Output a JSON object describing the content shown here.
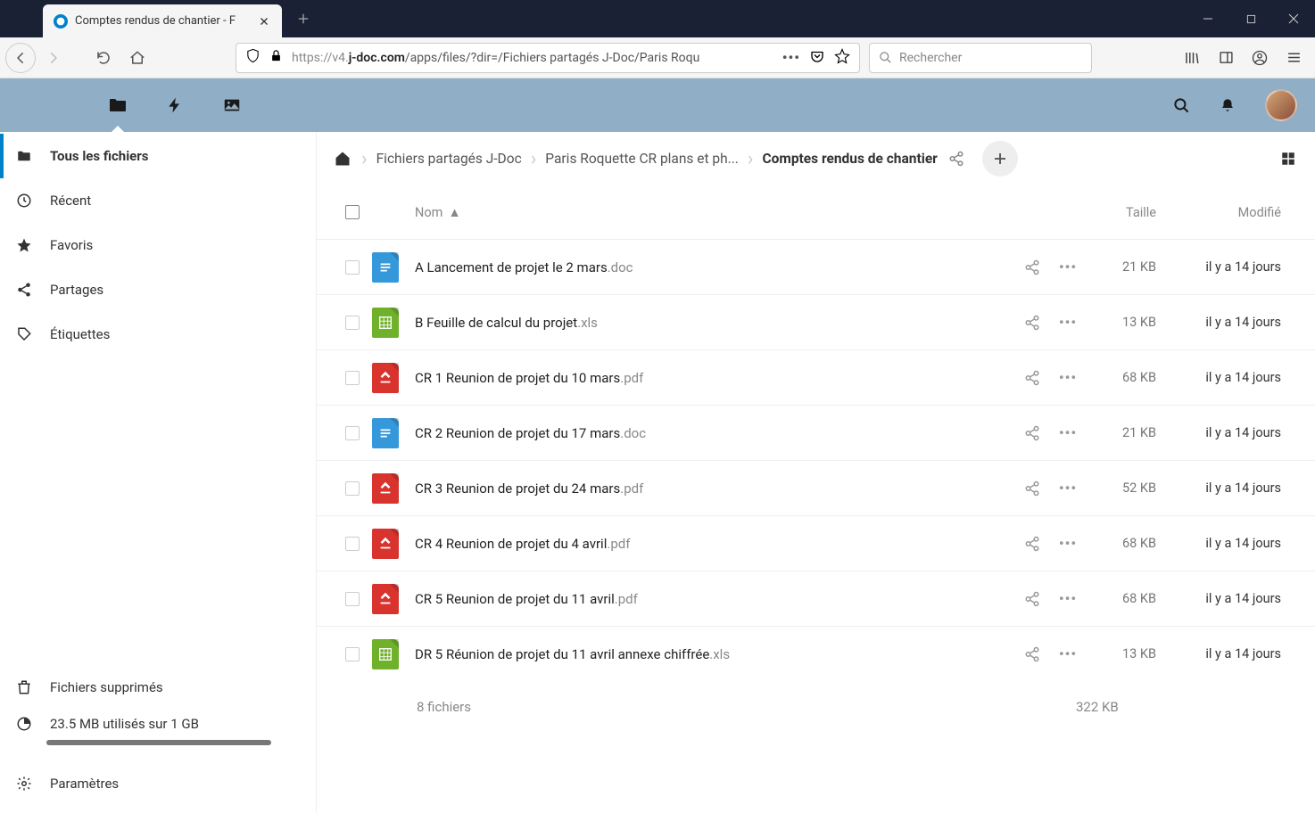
{
  "browser": {
    "tab_title": "Comptes rendus de chantier - F",
    "url_proto": "https://v4.",
    "url_domain": "j-doc.com",
    "url_path": "/apps/files/?dir=/Fichiers partagés J-Doc/Paris Roqu",
    "search_placeholder": "Rechercher"
  },
  "sidebar": {
    "items": [
      {
        "label": "Tous les fichiers",
        "icon": "folder"
      },
      {
        "label": "Récent",
        "icon": "clock"
      },
      {
        "label": "Favoris",
        "icon": "star"
      },
      {
        "label": "Partages",
        "icon": "share"
      },
      {
        "label": "Étiquettes",
        "icon": "tag"
      }
    ],
    "footer": {
      "trash": "Fichiers supprimés",
      "quota": "23.5 MB utilisés sur 1 GB",
      "settings": "Paramètres"
    }
  },
  "breadcrumb": {
    "items": [
      "Fichiers partagés J-Doc",
      "Paris Roquette CR plans et ph...",
      "Comptes rendus de chantier"
    ]
  },
  "columns": {
    "name": "Nom",
    "size": "Taille",
    "modified": "Modifié"
  },
  "files": [
    {
      "name": "A Lancement de projet le 2 mars",
      "ext": ".doc",
      "type": "doc",
      "size": "21 KB",
      "date": "il y a 14 jours"
    },
    {
      "name": "B Feuille de calcul du projet",
      "ext": ".xls",
      "type": "xls",
      "size": "13 KB",
      "date": "il y a 14 jours"
    },
    {
      "name": "CR 1 Reunion de projet du 10 mars",
      "ext": ".pdf",
      "type": "pdf",
      "size": "68 KB",
      "date": "il y a 14 jours"
    },
    {
      "name": "CR 2 Reunion de projet du 17 mars",
      "ext": ".doc",
      "type": "doc",
      "size": "21 KB",
      "date": "il y a 14 jours"
    },
    {
      "name": "CR 3 Reunion de projet du 24 mars",
      "ext": ".pdf",
      "type": "pdf",
      "size": "52 KB",
      "date": "il y a 14 jours"
    },
    {
      "name": "CR 4 Reunion de projet du 4 avril",
      "ext": ".pdf",
      "type": "pdf",
      "size": "68 KB",
      "date": "il y a 14 jours"
    },
    {
      "name": "CR 5 Reunion de projet du 11 avril",
      "ext": ".pdf",
      "type": "pdf",
      "size": "68 KB",
      "date": "il y a 14 jours"
    },
    {
      "name": "DR 5 Réunion de projet du 11 avril annexe chiffrée",
      "ext": ".xls",
      "type": "xls",
      "size": "13 KB",
      "date": "il y a 14 jours"
    }
  ],
  "summary": {
    "count": "8 fichiers",
    "size": "322 KB"
  }
}
